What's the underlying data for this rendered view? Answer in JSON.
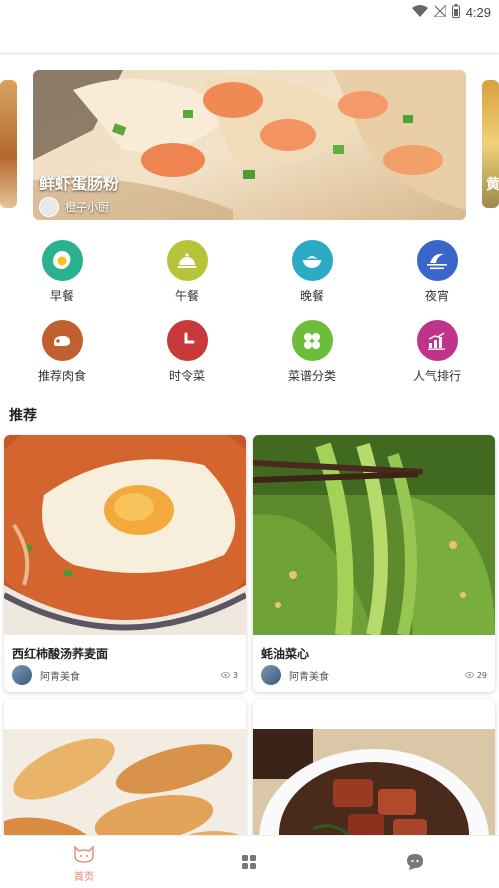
{
  "status_bar": {
    "time": "4:29",
    "icons": [
      "wifi-icon",
      "no-signal-icon",
      "battery-icon"
    ]
  },
  "banner": {
    "title": "鲜虾蛋肠粉",
    "author": "橙子小厨",
    "right_peek_text": "黄"
  },
  "categories": [
    {
      "label": "早餐",
      "icon": "egg-icon",
      "color": "#2ab28f"
    },
    {
      "label": "午餐",
      "icon": "cloche-icon",
      "color": "#b7c43a"
    },
    {
      "label": "晚餐",
      "icon": "bowl-icon",
      "color": "#2baac4"
    },
    {
      "label": "夜宵",
      "icon": "moon-icon",
      "color": "#3a66c9"
    },
    {
      "label": "推荐肉食",
      "icon": "meat-icon",
      "color": "#c0602e"
    },
    {
      "label": "时令菜",
      "icon": "clock-icon",
      "color": "#c9383a"
    },
    {
      "label": "菜谱分类",
      "icon": "grid-leaf-icon",
      "color": "#6cbd3a"
    },
    {
      "label": "人气排行",
      "icon": "chart-icon",
      "color": "#c0338a"
    }
  ],
  "section": {
    "title": "推荐"
  },
  "recipes": [
    {
      "title": "西红柿酸汤荞麦面",
      "author": "阿青美食",
      "views": "3"
    },
    {
      "title": "蚝油菜心",
      "author": "阿青美食",
      "views": "29"
    },
    {
      "title": "",
      "author": "",
      "views": ""
    },
    {
      "title": "",
      "author": "",
      "views": ""
    }
  ],
  "bottom_nav": [
    {
      "label": "首页",
      "icon": "cat-face-icon",
      "active": true
    },
    {
      "label": "",
      "icon": "grid-icon",
      "active": false
    },
    {
      "label": "",
      "icon": "chat-bubble-icon",
      "active": false
    }
  ],
  "colors": {
    "accent": "#e8806e"
  }
}
